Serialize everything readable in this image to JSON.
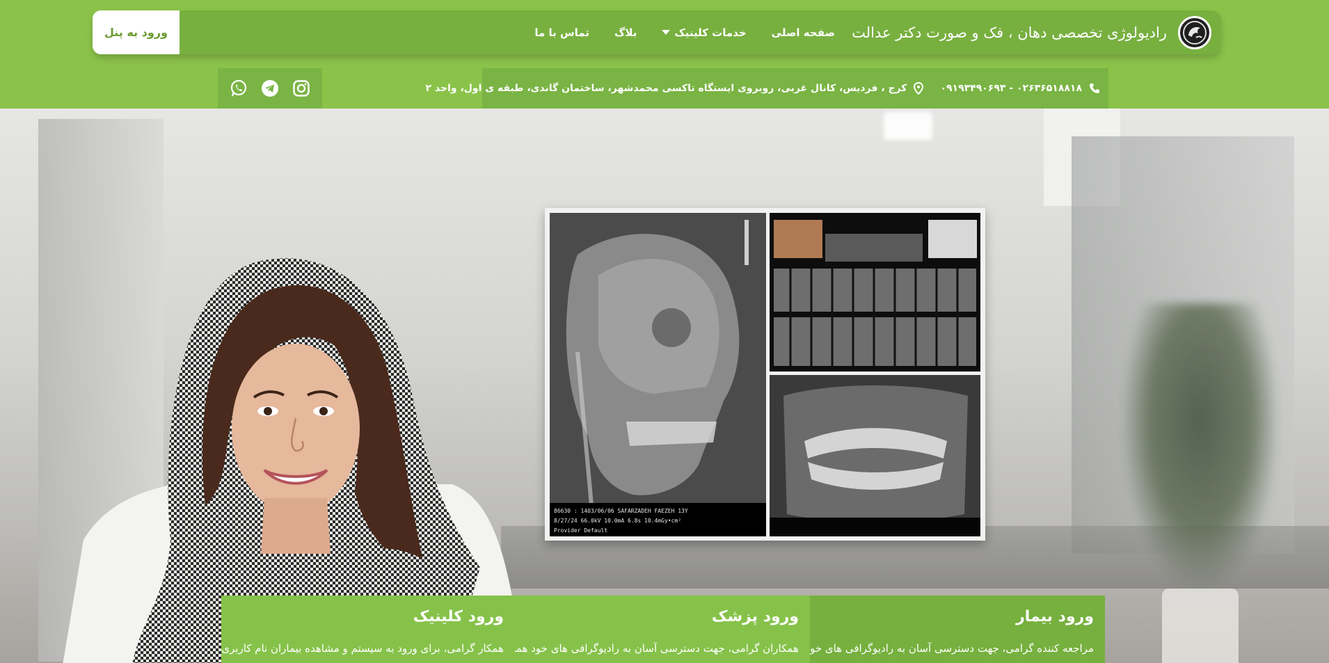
{
  "header": {
    "login_button": "ورود به پنل",
    "brand_title": "رادیولوژی تخصصی دهان ، فک و صورت دکتر عدالت",
    "menu": [
      {
        "label": "صفحه اصلی"
      },
      {
        "label": "خدمات کلینیک"
      },
      {
        "label": "بلاگ"
      },
      {
        "label": "تماس با ما"
      }
    ]
  },
  "contact_bar": {
    "phones": "۰۲۶۳۶۵۱۸۸۱۸ - ۰۹۱۹۳۴۹۰۶۹۳",
    "address": "کرج ، فردیس، کانال غربی، روبروی ایستگاه تاکسی محمدشهر، ساختمان گاندی، طبقه ی اول، واحد ۲"
  },
  "socials": [
    "whatsapp-icon",
    "telegram-icon",
    "instagram-icon"
  ],
  "hero": {
    "xray_caption_lines": [
      "86630 : 1403/06/06 SAFARZADEH FAEZEH 13Y",
      "8/27/24 66.0kV 10.0mA 6.8s 10.4mGy•cm²",
      "Provider Default"
    ]
  },
  "cards": [
    {
      "title": "ورود بیمار",
      "desc": "مراجعه کننده گرامی، جهت دسترسی آسان به رادیوگرافی های خود"
    },
    {
      "title": "ورود پزشک",
      "desc": "همکاران گرامی، جهت دسترسی آسان به رادیوگرافی های خود همراه"
    },
    {
      "title": "ورود کلینیک",
      "desc": "همکار گرامی، برای ورود به سیستم و مشاهده بیماران نام کاربری و"
    }
  ],
  "colors": {
    "brand_green": "#8bc34a",
    "nav_green": "#78b040",
    "card_green": "#86c24a"
  }
}
